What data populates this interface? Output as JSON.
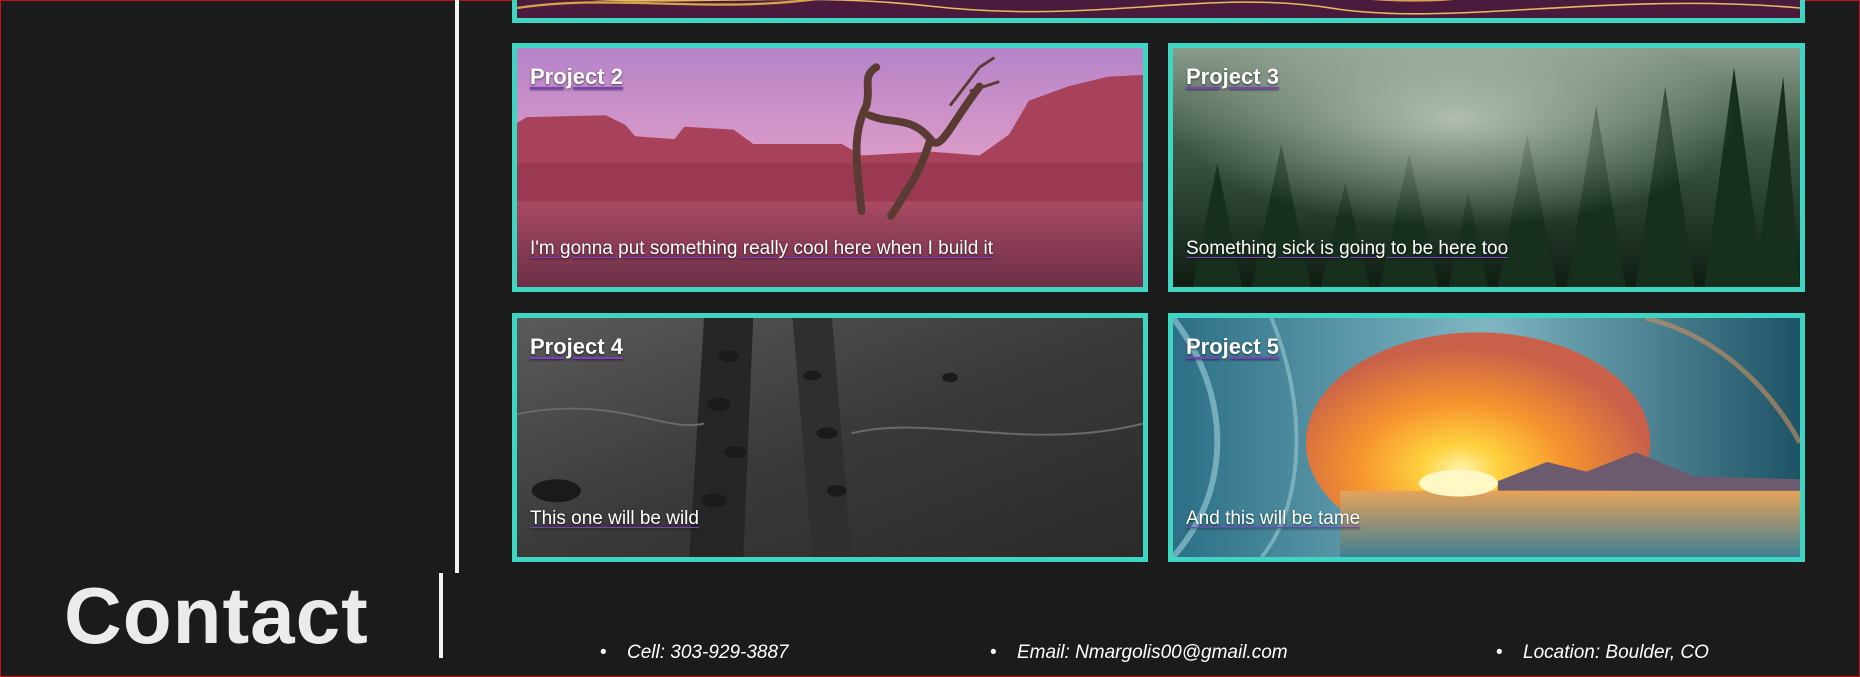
{
  "projects": [
    {
      "title": "Project 2",
      "description": "I'm gonna put something really cool here when I build it"
    },
    {
      "title": "Project 3",
      "description": "Something sick is going to be here too"
    },
    {
      "title": "Project 4",
      "description": "This one will be wild"
    },
    {
      "title": "Project 5",
      "description": "And this will be tame"
    }
  ],
  "contact": {
    "heading": "Contact",
    "cell": "Cell: 303-929-3887",
    "email": "Email: Nmargolis00@gmail.com",
    "location": "Location: Boulder, CO"
  },
  "colors": {
    "background": "#1b1b1b",
    "card_border": "#3ed6c3",
    "link_underline": "#7b3fbf",
    "divider": "#f2f2f2"
  },
  "icons": [
    "bullet-icon"
  ]
}
